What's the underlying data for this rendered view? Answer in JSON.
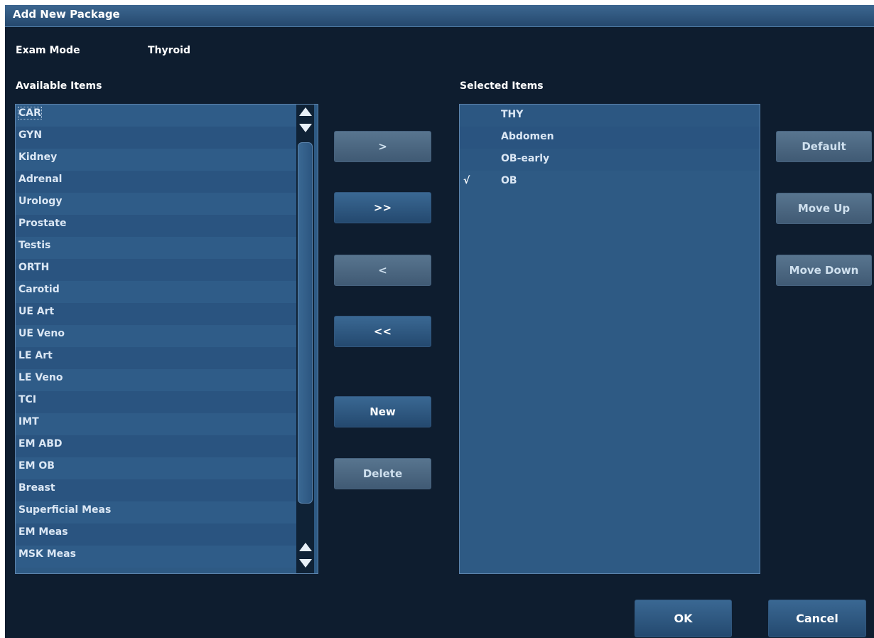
{
  "dialog": {
    "title": "Add New Package"
  },
  "exam_mode": {
    "label": "Exam Mode",
    "value": "Thyroid"
  },
  "available": {
    "title": "Available Items",
    "items": [
      "CAR",
      "GYN",
      "Kidney",
      "Adrenal",
      "Urology",
      "Prostate",
      "Testis",
      "ORTH",
      "Carotid",
      "UE Art",
      "UE Veno",
      "LE Art",
      "LE Veno",
      "TCI",
      "IMT",
      "EM ABD",
      "EM OB",
      "Breast",
      "Superficial Meas",
      "EM Meas",
      "MSK Meas"
    ],
    "focused_index": 0
  },
  "selected": {
    "title": "Selected Items",
    "items": [
      {
        "check": "",
        "label": "THY"
      },
      {
        "check": "",
        "label": "Abdomen"
      },
      {
        "check": "",
        "label": "OB-early"
      },
      {
        "check": "√",
        "label": "OB"
      }
    ]
  },
  "buttons": {
    "add": ">",
    "add_all": ">>",
    "remove": "<",
    "remove_all": "<<",
    "new": "New",
    "delete": "Delete",
    "default": "Default",
    "move_up": "Move Up",
    "move_down": "Move Down",
    "ok": "OK",
    "cancel": "Cancel"
  },
  "colors": {
    "background": "#0e1d2f",
    "list_bg": "#2e5a84",
    "button": "#2f5a86",
    "disabled_button": "#4e6a86"
  }
}
